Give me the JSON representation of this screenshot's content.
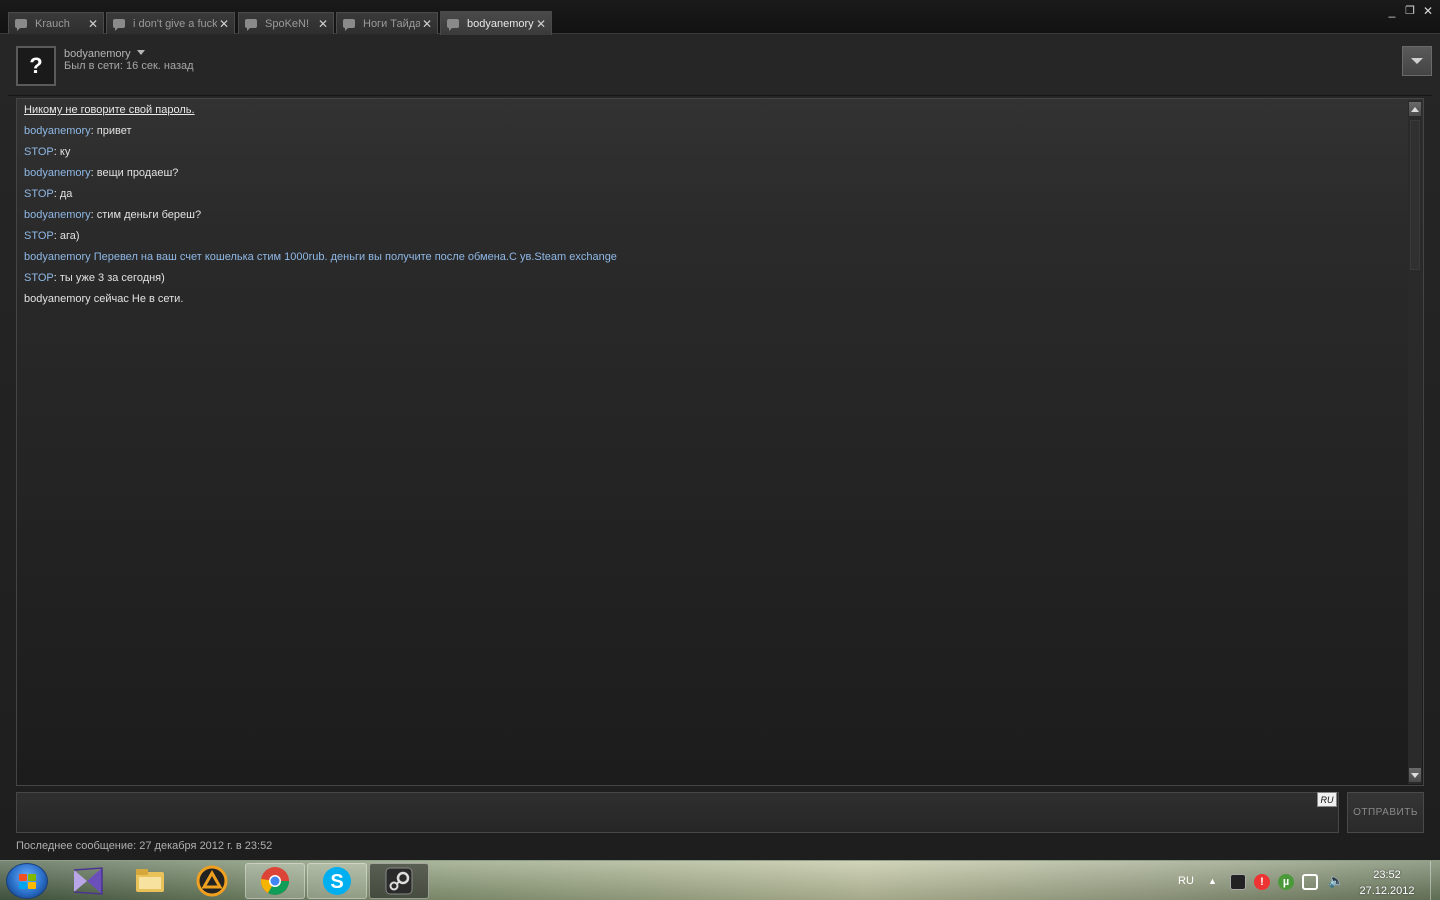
{
  "tabs": [
    {
      "label": "Krauch"
    },
    {
      "label": "i don't give a fuck"
    },
    {
      "label": "SpoKeN!"
    },
    {
      "label": "Ноги Тайда"
    },
    {
      "label": "bodyanemory"
    }
  ],
  "window_controls": {
    "minimize": "_",
    "maximize": "❐",
    "close": "✕"
  },
  "header": {
    "avatar_glyph": "?",
    "username": "bodyanemory",
    "status": "Был в сети: 16 сек. назад"
  },
  "messages": {
    "warning": "Никому не говорите свой пароль.",
    "lines": [
      {
        "name": "bodyanemory",
        "text": ": привет"
      },
      {
        "name": "STOP",
        "text": ": ку"
      },
      {
        "name": "bodyanemory",
        "text": ": вещи продаеш?"
      },
      {
        "name": "STOP",
        "text": ": да"
      },
      {
        "name": "bodyanemory",
        "text": ": стим деньги береш?"
      },
      {
        "name": "STOP",
        "text": ": ага)"
      }
    ],
    "broadcast": "bodyanemory Перевел на ваш счет кошелька стим 1000rub. деньги вы получите после обмена.С ув.Steam exchange",
    "after": {
      "name": "STOP",
      "text": ": ты уже 3 за сегодня)"
    },
    "offline": "bodyanemory сейчас Не в сети."
  },
  "composer": {
    "value": "",
    "language": "RU",
    "send_label": "ОТПРАВИТЬ",
    "last_message": "Последнее сообщение: 27 декабря 2012 г. в 23:52"
  },
  "taskbar": {
    "lang": "RU",
    "time": "23:52",
    "date": "27.12.2012",
    "skype_letter": "S"
  },
  "colors": {
    "accent_name": "#8fb8e6",
    "background": "#1e1e1e"
  }
}
